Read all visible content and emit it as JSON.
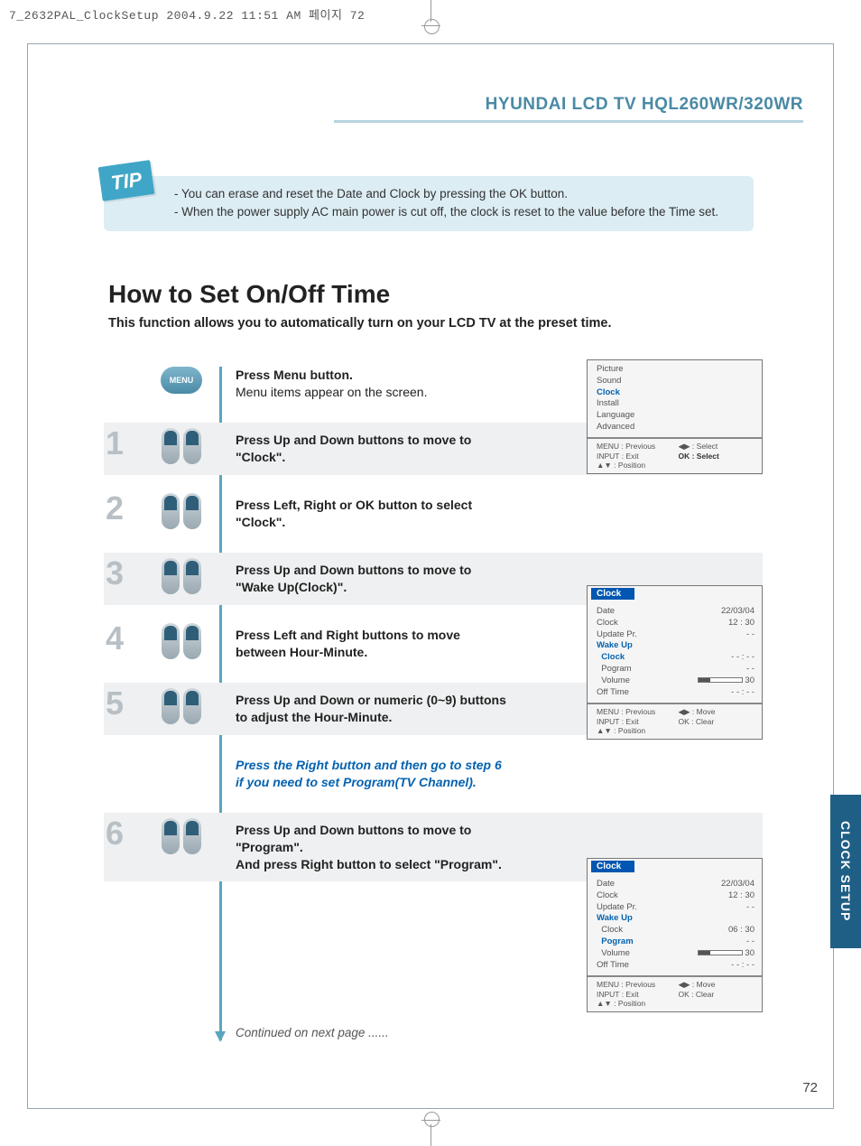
{
  "print_header": "7_2632PAL_ClockSetup  2004.9.22 11:51 AM  페이지 72",
  "header_title": "HYUNDAI LCD TV HQL260WR/320WR",
  "side_tab": "CLOCK SETUP",
  "page_number": "72",
  "tip": {
    "badge": "TIP",
    "line1": "- You can erase and reset the Date and Clock by pressing the OK button.",
    "line2": "- When the power supply AC main power is cut off, the clock is reset to the value before the Time set."
  },
  "heading": "How to Set On/Off Time",
  "subheading": "This function allows you to automatically turn on your LCD TV at the preset time.",
  "steps": {
    "s0": {
      "l1": "Press Menu button.",
      "l2": "Menu items appear on the screen.",
      "icon_label": "MENU"
    },
    "s1": {
      "num": "1",
      "l1": "Press Up and Down buttons to move to",
      "l2": "\"Clock\"."
    },
    "s2": {
      "num": "2",
      "l1": "Press Left, Right or OK button to select",
      "l2": "\"Clock\"."
    },
    "s3": {
      "num": "3",
      "l1": "Press Up and Down buttons to move to",
      "l2": "\"Wake Up(Clock)\"."
    },
    "s4": {
      "num": "4",
      "l1": "Press Left and Right buttons to move",
      "l2": "between Hour-Minute."
    },
    "s5": {
      "num": "5",
      "l1": "Press Up and Down or numeric (0~9) buttons",
      "l2": "to adjust the Hour-Minute."
    },
    "note": {
      "l1": "Press the Right button and then go to step 6",
      "l2": "if you need to set Program(TV Channel)."
    },
    "s6": {
      "num": "6",
      "l1": "Press Up and Down buttons to move to",
      "l2": "\"Program\".",
      "l3": "And press Right button to select \"Program\"."
    }
  },
  "continued": "Continued on next page ......",
  "osd1": {
    "items": [
      "Picture",
      "Sound",
      "Clock",
      "Install",
      "Language",
      "Advanced"
    ],
    "highlight_index": 2,
    "footer": {
      "a1": "MENU : Previous",
      "b1": "◀▶ : Select",
      "a2": "INPUT : Exit",
      "b2": "OK : Select",
      "a3": "▲▼ : Position",
      "b3": ""
    }
  },
  "osd2": {
    "title": "Clock",
    "rows": [
      {
        "k": "Date",
        "v": "22/03/04"
      },
      {
        "k": "Clock",
        "v": "12 : 30"
      },
      {
        "k": "Update Pr.",
        "v": "- -"
      },
      {
        "k": "Wake Up",
        "v": "",
        "blue": true
      },
      {
        "k": "  Clock",
        "v": "- - : - -",
        "blue": true
      },
      {
        "k": "  Pogram",
        "v": "- -"
      },
      {
        "k": "  Volume",
        "v": "30",
        "bar": true
      },
      {
        "k": "Off Time",
        "v": "- - : - -"
      }
    ],
    "footer": {
      "a1": "MENU : Previous",
      "b1": "◀▶ : Move",
      "a2": "INPUT : Exit",
      "b2": "OK : Clear",
      "a3": "▲▼ : Position",
      "b3": ""
    }
  },
  "osd3": {
    "title": "Clock",
    "rows": [
      {
        "k": "Date",
        "v": "22/03/04"
      },
      {
        "k": "Clock",
        "v": "12 : 30"
      },
      {
        "k": "Update Pr.",
        "v": "- -"
      },
      {
        "k": "Wake Up",
        "v": "",
        "blue": true
      },
      {
        "k": "  Clock",
        "v": "06 : 30"
      },
      {
        "k": "  Pogram",
        "v": "- -",
        "blue": true
      },
      {
        "k": "  Volume",
        "v": "30",
        "bar": true
      },
      {
        "k": "Off Time",
        "v": "- - : - -"
      }
    ],
    "footer": {
      "a1": "MENU : Previous",
      "b1": "◀▶ : Move",
      "a2": "INPUT : Exit",
      "b2": "OK : Clear",
      "a3": "▲▼ : Position",
      "b3": ""
    }
  }
}
